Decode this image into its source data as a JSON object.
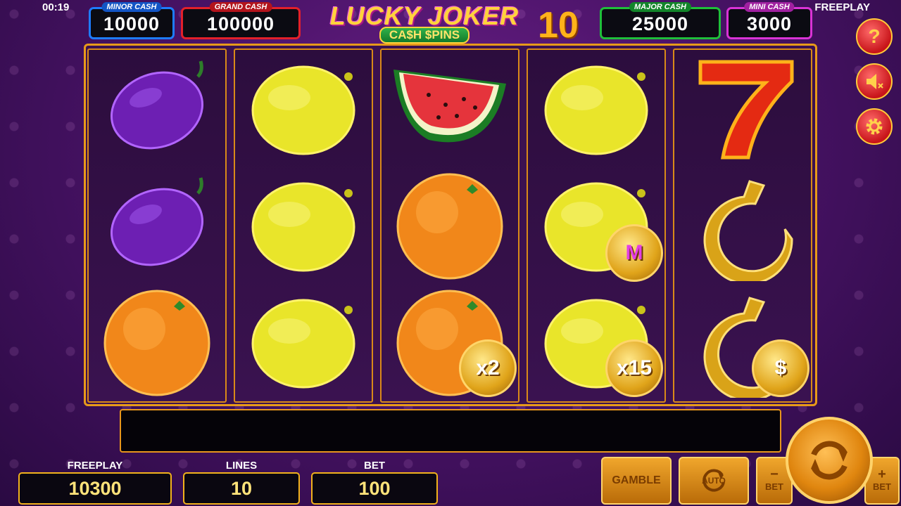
{
  "status": {
    "clock": "00:19",
    "mode": "FREEPLAY"
  },
  "jackpots": [
    {
      "id": "minor",
      "label": "MINOR CASH",
      "amount": "10000",
      "color": "#1e7cff"
    },
    {
      "id": "grand",
      "label": "GRAND CASH",
      "amount": "100000",
      "color": "#e3202a"
    },
    {
      "id": "major",
      "label": "MAJOR CASH",
      "amount": "25000",
      "color": "#1fbf3a"
    },
    {
      "id": "mini",
      "label": "MINI CASH",
      "amount": "3000",
      "color": "#d933d6"
    }
  ],
  "logo": {
    "line1": "LUCKY JOKER",
    "number": "10",
    "line2": "CA$H $PINS"
  },
  "side_buttons": [
    "help-icon",
    "sound-muted-icon",
    "settings-icon"
  ],
  "reels": [
    [
      "plum",
      "plum",
      "orange"
    ],
    [
      "lemon",
      "lemon",
      "lemon"
    ],
    [
      "watermelon",
      "orange",
      "orange"
    ],
    [
      "lemon",
      "lemon",
      "lemon"
    ],
    [
      "seven",
      "horseshoe",
      "horseshoe"
    ]
  ],
  "coins": {
    "r2": "x2",
    "r3a": "M",
    "r3b": "x15",
    "r4": "$"
  },
  "bottom": {
    "freeplay_label": "FREEPLAY",
    "freeplay_value": "10300",
    "lines_label": "LINES",
    "lines_value": "10",
    "bet_label": "BET",
    "bet_value": "100"
  },
  "controls": {
    "gamble": "GAMBLE",
    "auto": "AUTO",
    "bet_minus": "−",
    "bet_plus": "+",
    "bet_text": "BET"
  }
}
